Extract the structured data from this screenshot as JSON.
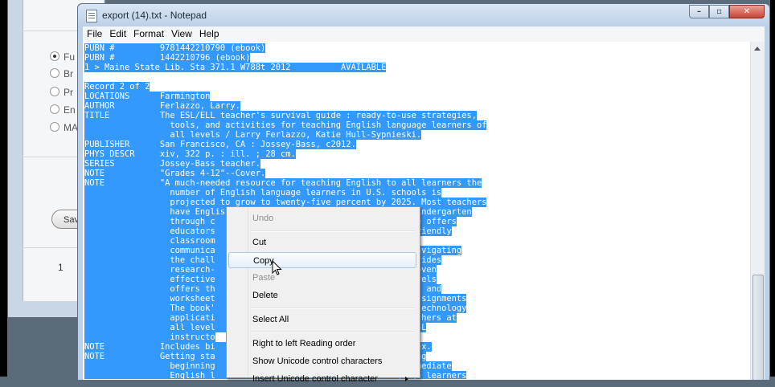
{
  "background_window": {
    "radio_options": [
      {
        "label": "Fu",
        "selected": true
      },
      {
        "label": "Br",
        "selected": false
      },
      {
        "label": "Pr",
        "selected": false
      },
      {
        "label": "En",
        "selected": false
      },
      {
        "label": "MA",
        "selected": false
      }
    ],
    "save_button": "Sav",
    "page_number": "1"
  },
  "notepad": {
    "title": "export (14).txt - Notepad",
    "menu": [
      "File",
      "Edit",
      "Format",
      "View",
      "Help"
    ],
    "lines": [
      "PUBN #         9781442210790 (ebook)",
      "PUBN #         1442210796 (ebook)",
      "1 > Maine State Lib. Sta 371.1 W788t 2012          AVAILABLE",
      "",
      "Record 2 of 2",
      "LOCATIONS      Farmington",
      "AUTHOR         Ferlazzo, Larry.",
      "TITLE          The ESL/ELL teacher's survival guide : ready-to-use strategies,",
      "                 tools, and activities for teaching English language learners of",
      "                 all levels / Larry Ferlazzo, Katie Hull-Sypnieski.",
      "PUBLISHER      San Francisco, CA : Jossey-Bass, c2012.",
      "PHYS DESCR     xiv, 322 p. : ill. ; 28 cm.",
      "SERIES         Jossey-Bass teacher.",
      "NOTE           \"Grades 4-12\"--Cover.",
      "NOTE           \"A much-needed resource for teaching English to all learners the",
      "                 number of English language learners in U.S. schools is",
      "                 projected to grow to twenty-five percent by 2025. Most teachers",
      "                 have English learners in their classrooms, from kindergarten",
      "                 through c                             rvival Guide offers",
      "                 educators                             up an ESL-friendly",
      "                 classroom                             students,",
      "                 communica                             ners, and navigating",
      "                 the chall                             udents. Provides",
      "                 research-                             ich have proven",
      "                 effective                             ficiency levels",
      "                 offers th                             ucible forms and",
      "                 worksheet                             e student assignments",
      "                 The book'                             ndards and technology",
      "                 applicati                             ive all teachers at",
      "                 all level                             effective ESL",
      "                 instructo",
      "NOTE           Includes bi                            312) and index.",
      "NOTE           Getting sta                            rs -- Teaching",
      "                 beginning                             ching intermediate",
      "                 English l                             ish language learners"
    ]
  },
  "context_menu": {
    "items": [
      {
        "label": "Undo",
        "disabled": true
      },
      {
        "separator": true
      },
      {
        "label": "Cut",
        "disabled": false
      },
      {
        "label": "Copy",
        "disabled": false,
        "hover": true
      },
      {
        "label": "Paste",
        "disabled": true
      },
      {
        "label": "Delete",
        "disabled": false
      },
      {
        "separator": true
      },
      {
        "label": "Select All",
        "disabled": false
      },
      {
        "separator": true
      },
      {
        "label": "Right to left Reading order",
        "disabled": false
      },
      {
        "label": "Show Unicode control characters",
        "disabled": false
      },
      {
        "label": "Insert Unicode control character",
        "disabled": false,
        "submenu": true
      }
    ]
  },
  "colors": {
    "selection": "#3399ff",
    "selection_text": "#ffffff"
  }
}
